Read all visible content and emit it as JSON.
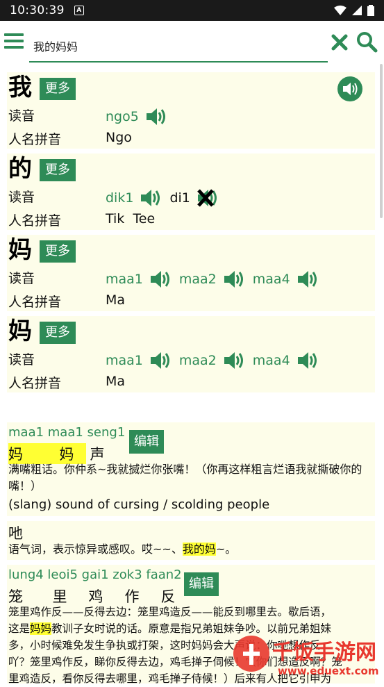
{
  "status_bar": {
    "time": "10:30:39",
    "notification_icon": "A"
  },
  "search": {
    "value": "我的妈妈",
    "placeholder": ""
  },
  "characters": [
    {
      "char": "我",
      "more_label": "更多",
      "reading_label": "读音",
      "readings": [
        "ngo5"
      ],
      "romanization_label": "人名拼音",
      "romanization": "Ngo"
    },
    {
      "char": "的",
      "more_label": "更多",
      "reading_label": "读音",
      "readings": [
        "dik1",
        "di1"
      ],
      "romanization_label": "人名拼音",
      "romanization": "Tik  Tee"
    },
    {
      "char": "妈",
      "more_label": "更多",
      "reading_label": "读音",
      "readings": [
        "maa1",
        "maa2",
        "maa4"
      ],
      "romanization_label": "人名拼音",
      "romanization": "Ma"
    },
    {
      "char": "妈",
      "more_label": "更多",
      "reading_label": "读音",
      "readings": [
        "maa1",
        "maa2",
        "maa4"
      ],
      "romanization_label": "人名拼音",
      "romanization": "Ma"
    }
  ],
  "entries": [
    {
      "jyutping": "maa1 maa1 seng1",
      "word": [
        "妈",
        "妈",
        "声"
      ],
      "edit_label": "编辑",
      "definition": "满嘴粗话。你仲系~我就搣烂你张嘴！（你再这样粗言烂语我就撕破你的嘴！）",
      "english": "(slang) sound of cursing / scolding people"
    },
    {
      "word_plain": "吔",
      "definition_pre": "语气词，表示惊异或感叹。哎~~、",
      "definition_hl": "我的妈",
      "definition_post": "~。"
    },
    {
      "jyutping": "lung4 leoi5 gai1 zok3 faan2",
      "word": [
        "笼",
        "里",
        "鸡",
        "作",
        "反"
      ],
      "edit_label": "编辑",
      "line1": "笼里鸡作反——反得去边：笼里鸡造反——能反到哪里去。歇后语，",
      "line2_pre": "这是",
      "line2_hl": "妈妈",
      "line2_post": "教训子女时说的话。原意是指兄弟姐妹争吵。以前兄弟姐妹",
      "line3": "多，小时候难免发生争执或打架，这时妈妈会大声说：你哋想作反",
      "line4": "吖？笼里鸡作反，睇你反得去边，鸡毛掸子伺候！”（你们想造反啊？笼",
      "line5": "里鸡造反，看你反得去哪里，鸡毛掸子侍候！）后来有人把它引申为"
    },
    {
      "watermark_text": "千饭手游网",
      "watermark_url": "www.eduext.com"
    }
  ],
  "colors": {
    "accent": "#2e8b57",
    "block_bg": "#fdfde9",
    "highlight": "#ffff33"
  }
}
